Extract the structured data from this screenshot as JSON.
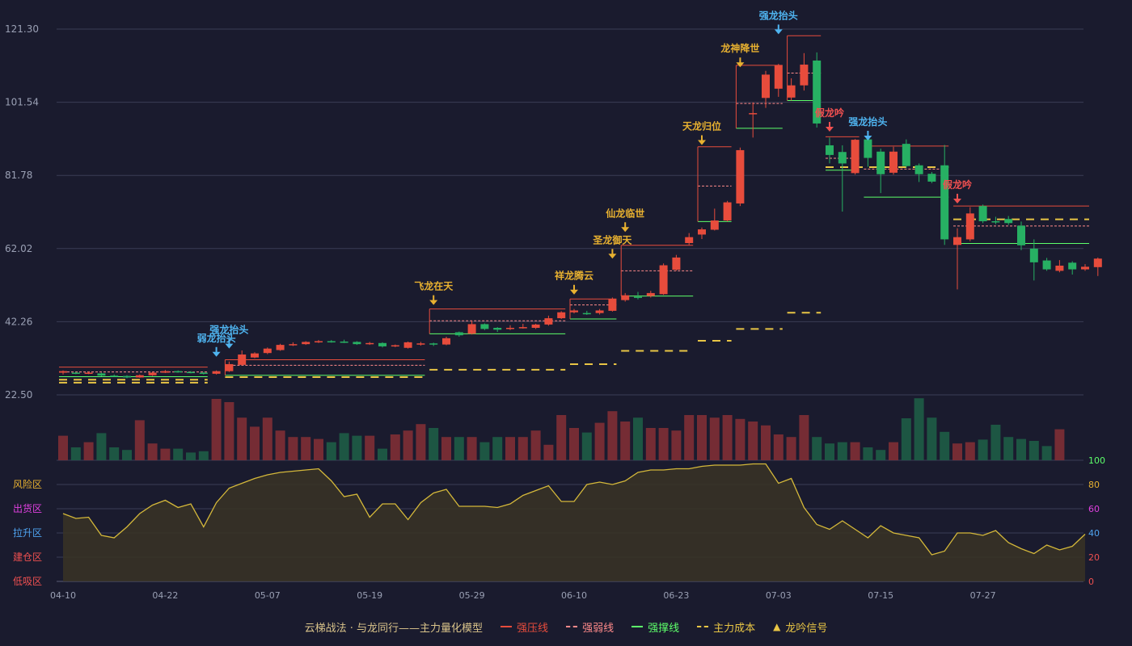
{
  "colors": {
    "background": "#1a1b2e",
    "up": "#e74c3c",
    "down": "#27b063",
    "strong_pressure": "#e74c3c",
    "strong_weak": "#ff8a8a",
    "strong_support": "#5dff6a",
    "main_cost": "#e8c545",
    "signal_gold": "#e8b130",
    "signal_blue": "#4fb4f0",
    "signal_red": "#f05050",
    "oscillator_line": "#d4b83a"
  },
  "legend": {
    "title": "云梯战法 · 与龙同行——主力量化模型",
    "strong_pressure": "强压线",
    "strong_weak": "强弱线",
    "strong_support": "强撑线",
    "main_cost": "主力成本",
    "dragon_signal": "龙吟信号"
  },
  "zones": {
    "risk": "风险区",
    "distribution": "出货区",
    "rally": "拉升区",
    "accumulate": "建仓区",
    "bottom": "低吸区"
  },
  "zone_colors": {
    "risk": "#e8b130",
    "distribution": "#e040e0",
    "rally": "#4fa3f0",
    "accumulate": "#f05050",
    "bottom": "#f05050"
  },
  "chart_data": {
    "type": "candlestick",
    "price_axis": {
      "ticks": [
        "121.30",
        "101.54",
        "81.78",
        "62.02",
        "42.26",
        "22.50"
      ],
      "range": [
        22.5,
        121.3
      ]
    },
    "osc_axis": {
      "ticks": [
        "100",
        "80",
        "60",
        "40",
        "20",
        "0"
      ],
      "range": [
        0,
        100
      ]
    },
    "x_ticks": [
      {
        "index": 0,
        "label": "04-10"
      },
      {
        "index": 8,
        "label": "04-22"
      },
      {
        "index": 16,
        "label": "05-07"
      },
      {
        "index": 24,
        "label": "05-19"
      },
      {
        "index": 32,
        "label": "05-29"
      },
      {
        "index": 40,
        "label": "06-10"
      },
      {
        "index": 48,
        "label": "06-23"
      },
      {
        "index": 56,
        "label": "07-03"
      },
      {
        "index": 64,
        "label": "07-15"
      },
      {
        "index": 72,
        "label": "07-27"
      }
    ],
    "candles": [
      [
        28.5,
        28.9,
        28.0,
        29.1
      ],
      [
        28.5,
        28.3,
        28.1,
        28.7
      ],
      [
        28.3,
        28.5,
        28.1,
        28.8
      ],
      [
        28.3,
        27.7,
        27.5,
        28.5
      ],
      [
        27.7,
        27.6,
        27.4,
        28.0
      ],
      [
        27.6,
        27.2,
        27.0,
        27.8
      ],
      [
        27.2,
        27.8,
        27.1,
        28.0
      ],
      [
        27.8,
        28.5,
        27.6,
        28.7
      ],
      [
        28.5,
        28.9,
        28.4,
        29.2
      ],
      [
        28.9,
        28.7,
        28.5,
        29.1
      ],
      [
        28.7,
        28.5,
        28.3,
        28.9
      ],
      [
        28.5,
        28.2,
        28.0,
        28.7
      ],
      [
        28.2,
        28.9,
        28.0,
        29.1
      ],
      [
        28.9,
        30.8,
        28.7,
        31.5
      ],
      [
        30.6,
        33.4,
        30.4,
        34.5
      ],
      [
        32.6,
        33.7,
        32.4,
        34.0
      ],
      [
        33.8,
        35.0,
        33.5,
        35.3
      ],
      [
        34.6,
        36.0,
        34.4,
        36.3
      ],
      [
        36.0,
        36.2,
        35.7,
        36.7
      ],
      [
        36.2,
        36.8,
        36.0,
        37.0
      ],
      [
        36.8,
        37.0,
        36.5,
        37.3
      ],
      [
        37.0,
        36.9,
        36.6,
        37.3
      ],
      [
        36.9,
        36.8,
        36.5,
        37.4
      ],
      [
        36.8,
        36.2,
        36.0,
        37.0
      ],
      [
        36.2,
        36.5,
        36.0,
        36.8
      ],
      [
        36.5,
        35.6,
        35.3,
        36.7
      ],
      [
        35.6,
        35.9,
        35.4,
        36.1
      ],
      [
        35.2,
        36.7,
        35.0,
        36.9
      ],
      [
        36.2,
        36.4,
        35.8,
        36.8
      ],
      [
        36.4,
        36.1,
        35.7,
        36.6
      ],
      [
        36.1,
        37.8,
        35.9,
        38.2
      ],
      [
        39.4,
        38.6,
        38.2,
        39.6
      ],
      [
        39.0,
        41.6,
        38.8,
        42.5
      ],
      [
        41.6,
        40.3,
        40.0,
        41.8
      ],
      [
        40.6,
        40.1,
        39.5,
        40.8
      ],
      [
        40.6,
        40.6,
        40.0,
        41.3
      ],
      [
        40.6,
        40.8,
        40.4,
        41.7
      ],
      [
        40.6,
        41.5,
        40.3,
        41.7
      ],
      [
        41.5,
        43.2,
        41.2,
        43.9
      ],
      [
        43.2,
        44.8,
        43.0,
        45.1
      ],
      [
        44.8,
        45.3,
        44.5,
        45.7
      ],
      [
        44.6,
        44.5,
        44.1,
        45.2
      ],
      [
        44.6,
        45.3,
        44.2,
        45.7
      ],
      [
        45.2,
        48.4,
        45.0,
        48.8
      ],
      [
        48.1,
        49.4,
        47.7,
        50.0
      ],
      [
        49.0,
        48.8,
        48.3,
        50.3
      ],
      [
        49.2,
        50.0,
        48.8,
        50.6
      ],
      [
        49.7,
        57.5,
        49.5,
        58.0
      ],
      [
        56.3,
        59.6,
        56.0,
        60.3
      ],
      [
        63.5,
        65.1,
        63.0,
        66.2
      ],
      [
        65.8,
        67.2,
        64.6,
        67.7
      ],
      [
        67.1,
        69.6,
        66.9,
        72.8
      ],
      [
        69.6,
        74.5,
        69.3,
        74.9
      ],
      [
        74.2,
        88.6,
        73.5,
        89.3
      ],
      [
        98.5,
        98.6,
        92.0,
        101.5
      ],
      [
        102.7,
        109.0,
        100.0,
        110.0
      ],
      [
        105.2,
        111.5,
        103.0,
        111.9
      ],
      [
        102.8,
        106.1,
        102.0,
        108.0
      ],
      [
        106.1,
        111.7,
        104.7,
        114.8
      ],
      [
        112.8,
        95.8,
        94.7,
        115.0
      ],
      [
        89.9,
        87.3,
        85.0,
        92.0
      ],
      [
        88.1,
        85.0,
        72.0,
        89.9
      ],
      [
        82.4,
        91.4,
        82.0,
        91.6
      ],
      [
        91.5,
        86.5,
        84.1,
        93.5
      ],
      [
        88.2,
        82.1,
        77.0,
        89.0
      ],
      [
        82.5,
        88.2,
        82.0,
        89.5
      ],
      [
        90.3,
        84.3,
        83.9,
        91.5
      ],
      [
        84.5,
        82.1,
        80.0,
        85.0
      ],
      [
        82.2,
        80.1,
        79.7,
        82.7
      ],
      [
        84.5,
        64.5,
        63.0,
        90.0
      ],
      [
        63.0,
        65.1,
        51.0,
        67.5
      ],
      [
        64.5,
        71.5,
        64.0,
        73.2
      ],
      [
        73.5,
        69.4,
        68.9,
        73.9
      ],
      [
        69.4,
        69.3,
        68.6,
        70.6
      ],
      [
        70.0,
        68.9,
        68.4,
        70.8
      ],
      [
        68.2,
        62.9,
        61.6,
        69.3
      ],
      [
        62.0,
        58.3,
        53.4,
        64.5
      ],
      [
        58.8,
        56.4,
        56.0,
        59.5
      ],
      [
        56.0,
        57.4,
        55.6,
        58.9
      ],
      [
        58.2,
        56.4,
        55.0,
        58.6
      ],
      [
        56.4,
        57.1,
        56.0,
        57.8
      ],
      [
        57.0,
        59.3,
        54.6,
        59.6
      ]
    ],
    "volume": [
      38,
      20,
      28,
      42,
      20,
      16,
      62,
      26,
      18,
      18,
      12,
      14,
      95,
      90,
      66,
      52,
      66,
      46,
      36,
      36,
      33,
      28,
      42,
      38,
      38,
      18,
      40,
      46,
      56,
      50,
      36,
      36,
      36,
      28,
      36,
      36,
      36,
      46,
      24,
      70,
      50,
      43,
      58,
      76,
      60,
      66,
      50,
      50,
      46,
      70,
      70,
      66,
      70,
      64,
      60,
      54,
      40,
      36,
      70,
      36,
      26,
      28,
      28,
      20,
      16,
      28,
      65,
      96,
      66,
      44,
      26,
      28,
      32,
      55,
      36,
      33,
      30,
      22,
      48
    ],
    "volume_max": 100,
    "oscillator": [
      56,
      52,
      53,
      38,
      36,
      45,
      56,
      63,
      67,
      61,
      64,
      45,
      65,
      77,
      81,
      85,
      88,
      90,
      91,
      92,
      93,
      83,
      70,
      72,
      53,
      64,
      64,
      51,
      65,
      73,
      76,
      62,
      62,
      62,
      61,
      64,
      71,
      75,
      79,
      66,
      66,
      80,
      82,
      80,
      83,
      90,
      92,
      92,
      93,
      93,
      95,
      96,
      96,
      96,
      97,
      97,
      81,
      85,
      61,
      47,
      43,
      50,
      43,
      36,
      46,
      40,
      38,
      36,
      22,
      25,
      40,
      40,
      38,
      42,
      32,
      27,
      23,
      30,
      26,
      29,
      39
    ],
    "series": [
      {
        "name": "强压线",
        "style": "solid",
        "color": "#e74c3c",
        "segments": [
          {
            "start": 0,
            "end": 11,
            "value": 30.0
          },
          {
            "start": 13,
            "end": 28,
            "value": 32.0
          },
          {
            "start": 29,
            "end": 39,
            "value": 45.7
          },
          {
            "start": 40,
            "end": 43,
            "value": 48.4
          },
          {
            "start": 44,
            "end": 49,
            "value": 62.9
          },
          {
            "start": 50,
            "end": 52,
            "value": 89.5
          },
          {
            "start": 53,
            "end": 56,
            "value": 111.5
          },
          {
            "start": 57,
            "end": 59,
            "value": 119.5
          },
          {
            "start": 60,
            "end": 62,
            "value": 92.2
          },
          {
            "start": 63,
            "end": 69,
            "value": 89.7
          },
          {
            "start": 70,
            "end": 80,
            "value": 73.5
          }
        ]
      },
      {
        "name": "强弱线",
        "style": "dashed",
        "color": "#ff8a8a",
        "segments": [
          {
            "start": 0,
            "end": 11,
            "value": 28.7
          },
          {
            "start": 13,
            "end": 28,
            "value": 30.5
          },
          {
            "start": 29,
            "end": 39,
            "value": 42.5
          },
          {
            "start": 40,
            "end": 43,
            "value": 46.8
          },
          {
            "start": 44,
            "end": 49,
            "value": 56.0
          },
          {
            "start": 50,
            "end": 52,
            "value": 78.9
          },
          {
            "start": 53,
            "end": 56,
            "value": 101.2
          },
          {
            "start": 57,
            "end": 59,
            "value": 109.4
          },
          {
            "start": 60,
            "end": 62,
            "value": 86.4
          },
          {
            "start": 63,
            "end": 69,
            "value": 83.5
          },
          {
            "start": 70,
            "end": 80,
            "value": 68.1
          }
        ]
      },
      {
        "name": "强撑线",
        "style": "solid",
        "color": "#5dff6a",
        "segments": [
          {
            "start": 0,
            "end": 11,
            "value": 27.4
          },
          {
            "start": 13,
            "end": 28,
            "value": 27.8
          },
          {
            "start": 29,
            "end": 39,
            "value": 39.0
          },
          {
            "start": 40,
            "end": 43,
            "value": 43.0
          },
          {
            "start": 44,
            "end": 49,
            "value": 49.2
          },
          {
            "start": 50,
            "end": 52,
            "value": 69.3
          },
          {
            "start": 53,
            "end": 56,
            "value": 94.5
          },
          {
            "start": 57,
            "end": 59,
            "value": 102.0
          },
          {
            "start": 60,
            "end": 62,
            "value": 83.2
          },
          {
            "start": 63,
            "end": 69,
            "value": 75.9
          },
          {
            "start": 70,
            "end": 80,
            "value": 63.4
          }
        ]
      },
      {
        "name": "主力成本",
        "style": "dashed",
        "color": "#e8c545",
        "segments": [
          {
            "start": 0,
            "end": 11,
            "value": 26.6
          },
          {
            "start": 0,
            "end": 11,
            "value": 25.8
          },
          {
            "start": 13,
            "end": 28,
            "value": 27.3
          },
          {
            "start": 29,
            "end": 39,
            "value": 29.3
          },
          {
            "start": 40,
            "end": 43,
            "value": 30.8
          },
          {
            "start": 44,
            "end": 49,
            "value": 34.4
          },
          {
            "start": 50,
            "end": 52,
            "value": 37.1
          },
          {
            "start": 53,
            "end": 56,
            "value": 40.3
          },
          {
            "start": 57,
            "end": 59,
            "value": 44.7
          },
          {
            "start": 60,
            "end": 69,
            "value": 84.0
          },
          {
            "start": 70,
            "end": 80,
            "value": 69.9
          }
        ]
      }
    ],
    "signals": [
      {
        "index": 12,
        "label": "弱龙抬头",
        "color": "blue",
        "price": 32.8
      },
      {
        "index": 13,
        "label": "强龙抬头",
        "color": "blue",
        "price": 35.0
      },
      {
        "index": 29,
        "label": "飞龙在天",
        "color": "gold",
        "price": 46.8
      },
      {
        "index": 40,
        "label": "祥龙腾云",
        "color": "gold",
        "price": 49.6
      },
      {
        "index": 43,
        "label": "圣龙御天",
        "color": "gold",
        "price": 59.3
      },
      {
        "index": 44,
        "label": "仙龙临世",
        "color": "gold",
        "price": 66.5
      },
      {
        "index": 50,
        "label": "天龙归位",
        "color": "gold",
        "price": 90.0
      },
      {
        "index": 53,
        "label": "龙神降世",
        "color": "gold",
        "price": 111.0
      },
      {
        "index": 56,
        "label": "强龙抬头",
        "color": "blue",
        "price": 119.9
      },
      {
        "index": 60,
        "label": "假龙吟",
        "color": "red",
        "price": 93.6
      },
      {
        "index": 63,
        "label": "假龙吟",
        "color": "blue_text_red_arrow",
        "price": 91.2,
        "override_label": "强龙抬头"
      },
      {
        "index": 70,
        "label": "假龙吟",
        "color": "red",
        "price": 74.2
      }
    ]
  }
}
